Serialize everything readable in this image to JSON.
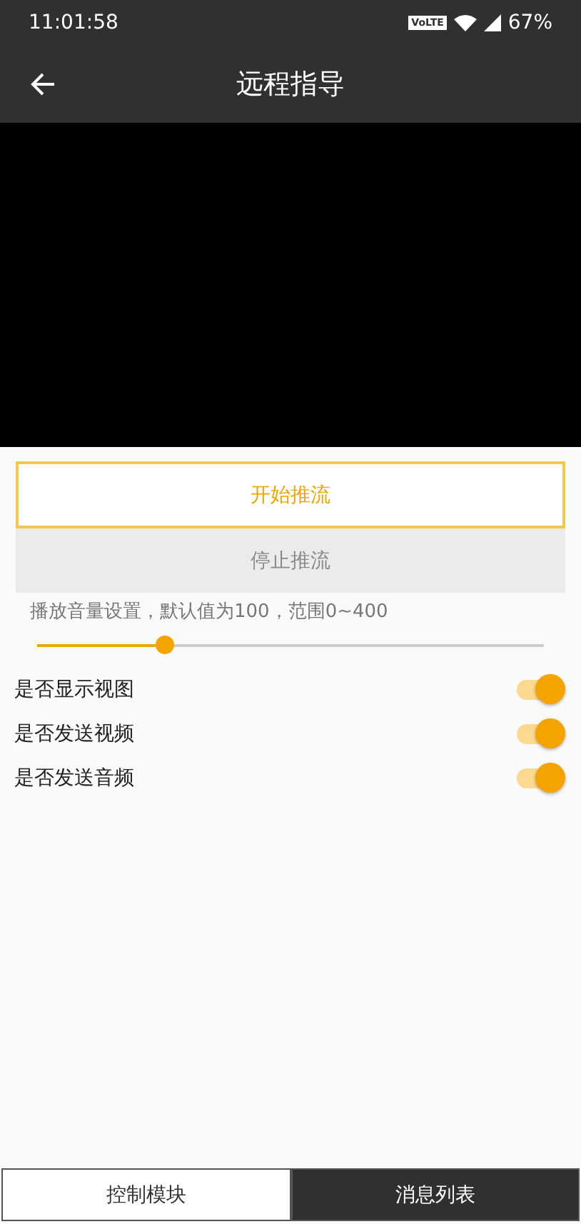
{
  "status_bar": {
    "time": "11:01:58",
    "network_badge": "VoLTE",
    "battery": "67%"
  },
  "toolbar": {
    "title": "远程指导"
  },
  "buttons": [
    {
      "label": "开始推流",
      "disabled": false
    },
    {
      "label": "停止推流",
      "disabled": true
    }
  ],
  "volume": {
    "caption": "播放音量设置，默认值为100，范围0~400",
    "level": 0.25
  },
  "switches": [
    {
      "label": "是否显示视图",
      "on": true
    },
    {
      "label": "是否发送视频",
      "on": true
    },
    {
      "label": "是否发送音频",
      "on": true
    }
  ],
  "tabs": [
    {
      "label": "控制模块",
      "selected": true
    },
    {
      "label": "消息列表",
      "selected": false
    }
  ]
}
